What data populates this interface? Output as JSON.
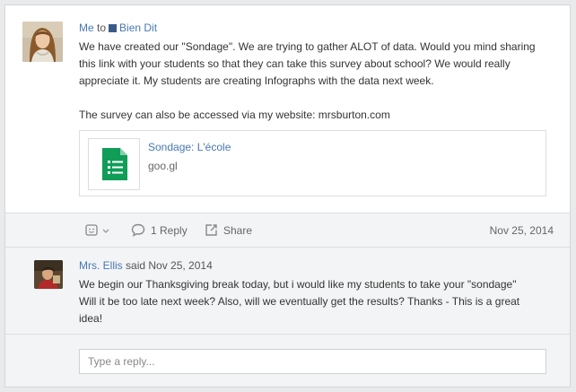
{
  "post": {
    "sender": "Me",
    "to_word": "to",
    "recipient": "Bien Dit",
    "body_paragraphs": [
      "We have created our \"Sondage\". We are trying to gather ALOT of data. Would you mind sharing this link with your students so that they can take this survey about school? We would really appreciate it. My students are creating Infographs with the data next week.",
      "The survey can also be accessed via my website: mrsburton.com"
    ],
    "attachment": {
      "title": "Sondage: L'école",
      "url": "goo.gl",
      "icon": "google-forms-icon"
    }
  },
  "actions": {
    "react_icon": "smiley-icon",
    "reply_label": "1 Reply",
    "share_label": "Share",
    "date": "Nov 25, 2014"
  },
  "reply": {
    "author": "Mrs. Ellis",
    "said_text": "said Nov 25, 2014",
    "body": "We begin our Thanksgiving break today, but i would like my students to take your \"sondage\" Will it be too late next week? Also, will we eventually get the results? Thanks - This is a great idea!"
  },
  "compose": {
    "placeholder": "Type a reply...",
    "value": ""
  },
  "colors": {
    "link": "#4878b4",
    "forms_green": "#0f9d58",
    "panel_gray": "#f3f4f5",
    "group_square": "#3a5b89"
  }
}
